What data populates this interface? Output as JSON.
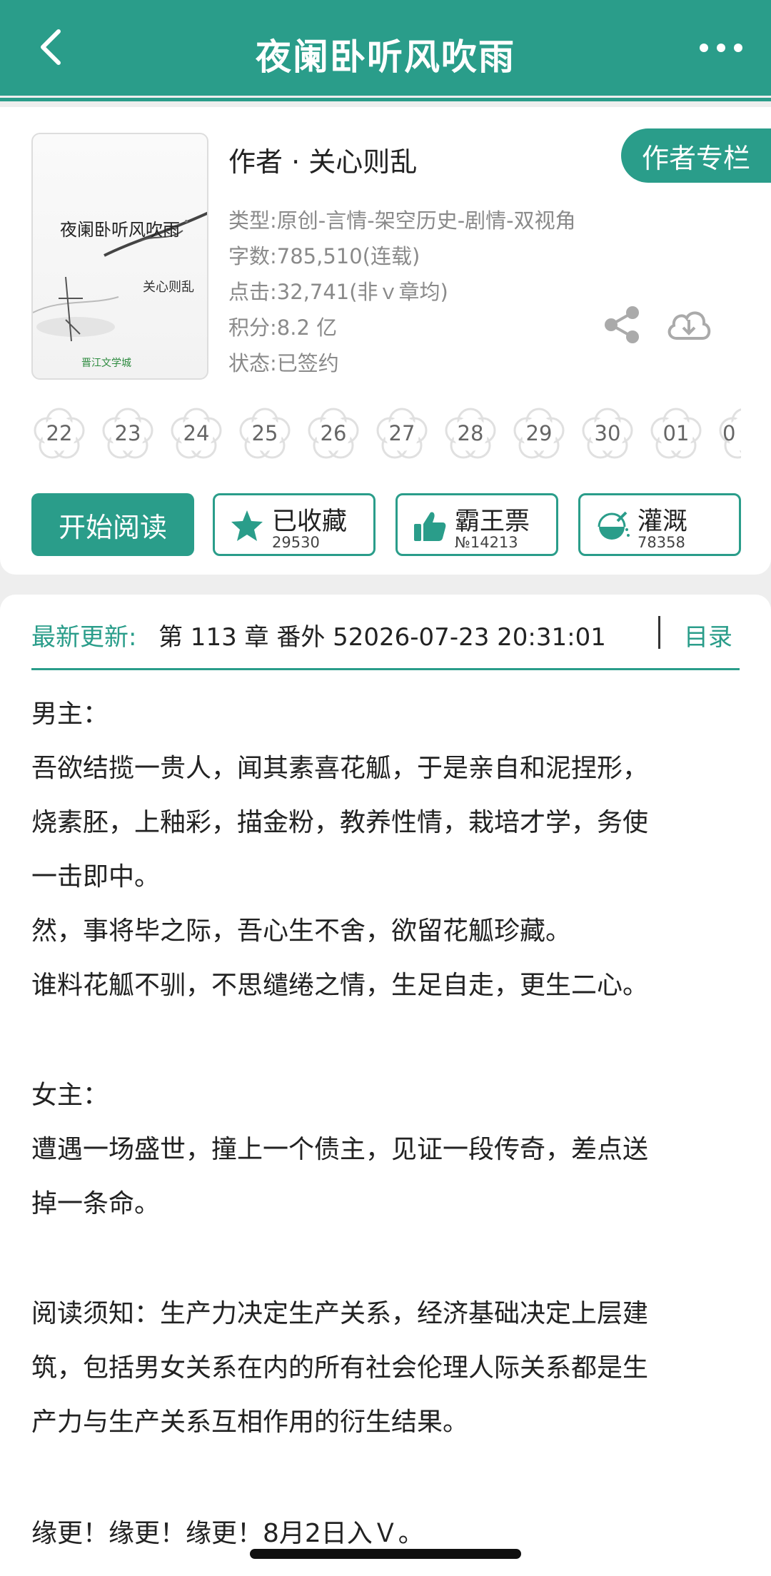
{
  "header": {
    "title": "夜阑卧听风吹雨"
  },
  "book": {
    "cover_title": "夜阑卧听风吹雨",
    "cover_author": "关心则乱",
    "cover_logo": "晋江文学城",
    "author": "作者 · 关心则乱",
    "author_column_button": "作者专栏",
    "type": "类型:原创-言情-架空历史-剧情-双视角",
    "word_count": "字数:785,510(连载)",
    "clicks": "点击:32,741(非ｖ章均)",
    "score": "积分:8.2 亿",
    "status": "状态:已签约"
  },
  "dates": [
    "22",
    "23",
    "24",
    "25",
    "26",
    "27",
    "28",
    "29",
    "30",
    "01",
    "0"
  ],
  "actions": {
    "read": "开始阅读",
    "favorite": {
      "label": "已收藏",
      "count": "29530"
    },
    "ticket": {
      "label": "霸王票",
      "count": "№14213"
    },
    "irrigate": {
      "label": "灌溉",
      "count": "78358"
    }
  },
  "update": {
    "label": "最新更新:",
    "text": "第 113 章 番外 52026-07-23 20:31:01",
    "toc": "目录"
  },
  "content": [
    "男主：",
    "吾欲结揽一贵人，闻其素喜花觚，于是亲自和泥捏形，",
    "烧素胚，上釉彩，描金粉，教养性情，栽培才学，务使",
    "一击即中。",
    "然，事将毕之际，吾心生不舍，欲留花觚珍藏。",
    "谁料花觚不驯，不思缱绻之情，生足自走，更生二心。",
    "女主：",
    "遭遇一场盛世，撞上一个债主，见证一段传奇，差点送",
    "掉一条命。",
    "阅读须知：生产力决定生产关系，经济基础决定上层建",
    "筑，包括男女关系在内的所有社会伦理人际关系都是生",
    "产力与生产关系互相作用的衍生结果。",
    "缘更！缘更！缘更！8月2日入Ｖ。"
  ],
  "colors": {
    "accent": "#2a9d8a"
  }
}
